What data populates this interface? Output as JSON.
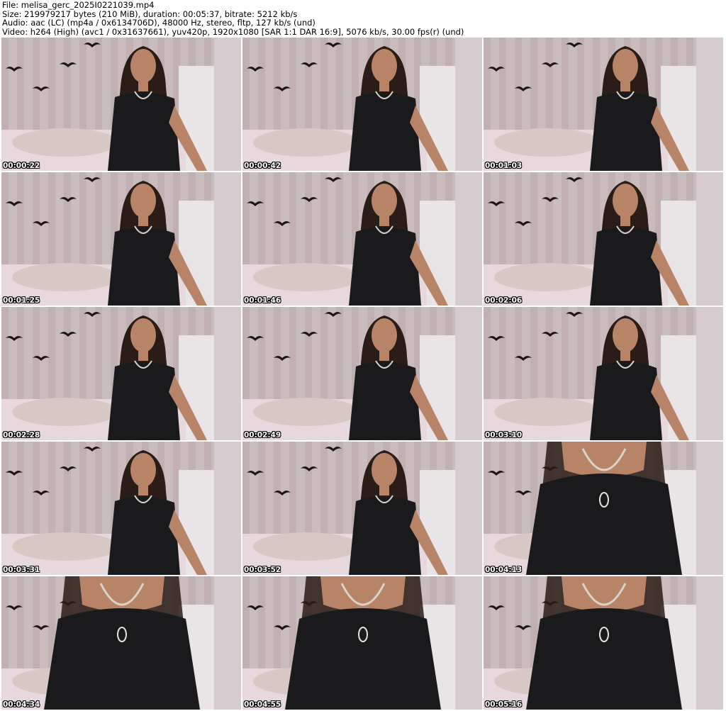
{
  "header": {
    "file_line": "File: melisa_gerc_2025I0221039.mp4",
    "size_line": "Size: 219979217 bytes (210 MiB), duration: 00:05:37, bitrate: 5212 kb/s",
    "audio_line": "Audio: aac (LC) (mp4a / 0x6134706D), 48000 Hz, stereo, fltp, 127 kb/s (und)",
    "video_line": "Video: h264 (High) (avc1 / 0x31637661), yuv420p, 1920x1080 [SAR 1:1 DAR 16:9], 5076 kb/s, 30.00 fps(r) (und)"
  },
  "thumbnails": [
    {
      "timestamp": "00:00:22",
      "shot": "wide"
    },
    {
      "timestamp": "00:00:42",
      "shot": "wide"
    },
    {
      "timestamp": "00:01:03",
      "shot": "wide"
    },
    {
      "timestamp": "00:01:25",
      "shot": "wide"
    },
    {
      "timestamp": "00:01:46",
      "shot": "wide"
    },
    {
      "timestamp": "00:02:06",
      "shot": "wide"
    },
    {
      "timestamp": "00:02:28",
      "shot": "wide"
    },
    {
      "timestamp": "00:02:49",
      "shot": "wide"
    },
    {
      "timestamp": "00:03:10",
      "shot": "wide"
    },
    {
      "timestamp": "00:03:31",
      "shot": "wide"
    },
    {
      "timestamp": "00:03:52",
      "shot": "wide"
    },
    {
      "timestamp": "00:04:13",
      "shot": "close"
    },
    {
      "timestamp": "00:04:34",
      "shot": "close"
    },
    {
      "timestamp": "00:04:55",
      "shot": "close"
    },
    {
      "timestamp": "00:05:16",
      "shot": "close"
    }
  ],
  "colors": {
    "wall": "#c9bcbc",
    "curtain": "#b8a6a8",
    "bed": "#e6d8dc",
    "pillow": "#d8c8c4",
    "shirt": "#1a1a1d",
    "skin": "#b88468",
    "hair": "#2a1c16",
    "bat": "#1e1416",
    "timestamp_text": "#ffffff"
  }
}
